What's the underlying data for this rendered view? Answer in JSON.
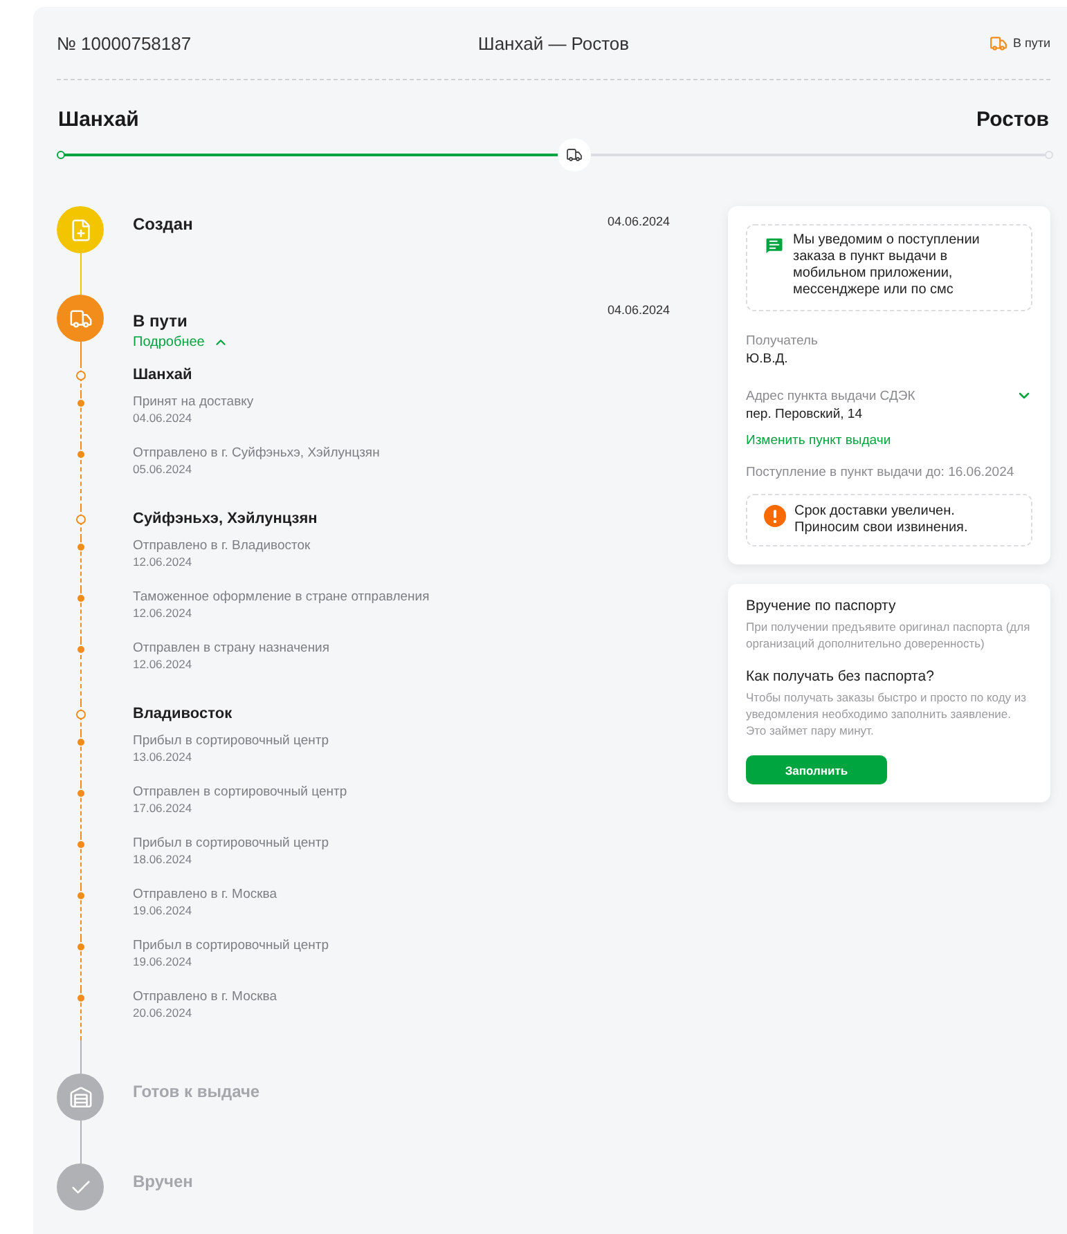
{
  "order": {
    "number": "№ 10000758187",
    "route": "Шанхай — Ростов",
    "status": "В пути"
  },
  "progress": {
    "from": "Шанхай",
    "to": "Ростов",
    "level": 0.52
  },
  "stages": [
    {
      "kind": "created",
      "title": "Создан",
      "date": "04.06.2024",
      "color": "#f2c500",
      "done": true
    },
    {
      "kind": "transit",
      "title": "В пути",
      "date": "04.06.2024",
      "color": "#f28c1b",
      "done": true,
      "more_link": "Подробнее",
      "expanded": true,
      "groups": [
        {
          "city": "Шанхай",
          "events": [
            {
              "text": "Принят на доставку",
              "date": "04.06.2024"
            },
            {
              "text": "Отправлено в г. Суйфэньхэ, Хэйлунцзян",
              "date": "05.06.2024"
            }
          ]
        },
        {
          "city": "Суйфэньхэ, Хэйлунцзян",
          "events": [
            {
              "text": "Отправлено в г. Владивосток",
              "date": "12.06.2024"
            },
            {
              "text": "Таможенное оформление в стране отправления",
              "date": "12.06.2024"
            },
            {
              "text": "Отправлен в страну назначения",
              "date": "12.06.2024"
            }
          ]
        },
        {
          "city": "Владивосток",
          "events": [
            {
              "text": "Прибыл в сортировочный центр",
              "date": "13.06.2024"
            },
            {
              "text": "Отправлен в сортировочный центр",
              "date": "17.06.2024"
            },
            {
              "text": "Прибыл в сортировочный центр",
              "date": "18.06.2024"
            },
            {
              "text": "Отправлено в г. Москва",
              "date": "19.06.2024"
            },
            {
              "text": "Прибыл в сортировочный центр",
              "date": "19.06.2024"
            },
            {
              "text": "Отправлено в г. Москва",
              "date": "20.06.2024"
            }
          ]
        }
      ]
    },
    {
      "kind": "ready",
      "title": "Готов к выдаче",
      "color": "#b0b1b5",
      "done": false
    },
    {
      "kind": "delivered",
      "title": "Вручен",
      "color": "#b0b1b5",
      "done": false
    }
  ],
  "pickup": {
    "notice": "Мы уведомим о поступлении заказа в пункт выдачи в мобильном приложении, мессенджере или по смс",
    "recipient_label": "Получатель",
    "recipient": "Ю.В.Д.",
    "address_label": "Адрес пункта выдачи СДЭК",
    "address_expanded": false,
    "address": "пер. Перовский, 14",
    "change_link": "Изменить пункт выдачи",
    "deadline": "Поступление в пункт выдачи до: 16.06.2024",
    "warning": "Срок доставки увеличен. Приносим свои извинения."
  },
  "passport": {
    "title": "Вручение по паспорту",
    "text": "При получении предъявите оригинал паспорта (для организаций дополнительно доверенность)",
    "question": "Как получать без паспорта?",
    "answer": "Чтобы получать заказы быстро и просто по коду из уведомления необходимо заполнить заявление. Это займет пару минут.",
    "button": "Заполнить"
  }
}
